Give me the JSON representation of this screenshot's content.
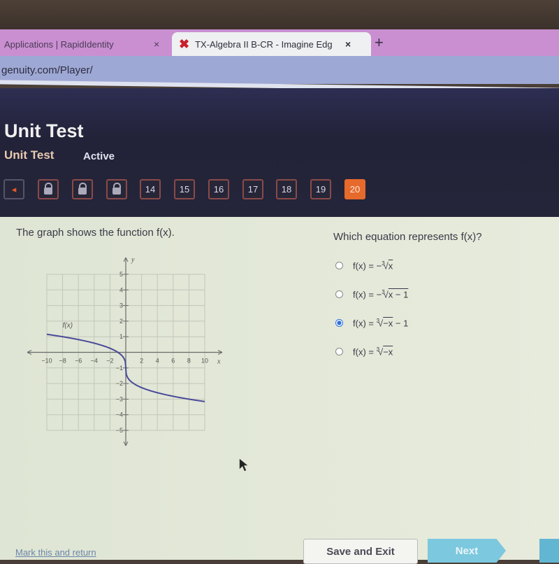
{
  "browser": {
    "tabs": [
      {
        "label": "Applications | RapidIdentity",
        "close": "×"
      },
      {
        "label": "TX-Algebra II B-CR - Imagine Edg",
        "close": "×",
        "icon": "x-logo-icon"
      }
    ],
    "new_tab": "+",
    "url": "genuity.com/Player/"
  },
  "header": {
    "title": "Unit Test",
    "subtitle": "Unit Test",
    "status": "Active"
  },
  "question_nav": {
    "prev": "◂",
    "locked_count": 3,
    "items": [
      "14",
      "15",
      "16",
      "17",
      "18",
      "19",
      "20"
    ],
    "current": "20"
  },
  "question": {
    "prompt": "The graph shows the function f(x).",
    "ask": "Which equation represents f(x)?",
    "options": [
      {
        "lhs": "f(x) = −",
        "index": "3",
        "radicand": "x",
        "tail": "",
        "selected": false
      },
      {
        "lhs": "f(x) = −",
        "index": "3",
        "radicand": "x − 1",
        "tail": "",
        "selected": false
      },
      {
        "lhs": "f(x) = ",
        "index": "3",
        "radicand": "−x",
        "tail": " − 1",
        "selected": true
      },
      {
        "lhs": "f(x) = ",
        "index": "3",
        "radicand": "−x",
        "tail": "",
        "selected": false
      }
    ]
  },
  "chart_data": {
    "type": "line",
    "title": "",
    "xlabel": "x",
    "ylabel": "y",
    "xlim": [
      -10,
      10
    ],
    "ylim": [
      -5,
      5
    ],
    "grid": true,
    "x_ticks": [
      "−10",
      "−8",
      "−6",
      "−4",
      "−2",
      "2",
      "4",
      "6",
      "8",
      "10"
    ],
    "y_ticks": [
      "5",
      "4",
      "3",
      "2",
      "1",
      "−1",
      "−2",
      "−3",
      "−4",
      "−5"
    ],
    "series": [
      {
        "name": "f(x)",
        "function": "cbrt(-x) - 1",
        "x_range": [
          -10,
          10
        ],
        "color": "#4a4a9a"
      }
    ],
    "annotations": [
      {
        "text": "f(x)",
        "near": "upper-left of curve"
      }
    ]
  },
  "footer": {
    "mark_link": "Mark this and return",
    "save_exit": "Save and Exit",
    "next": "Next"
  }
}
